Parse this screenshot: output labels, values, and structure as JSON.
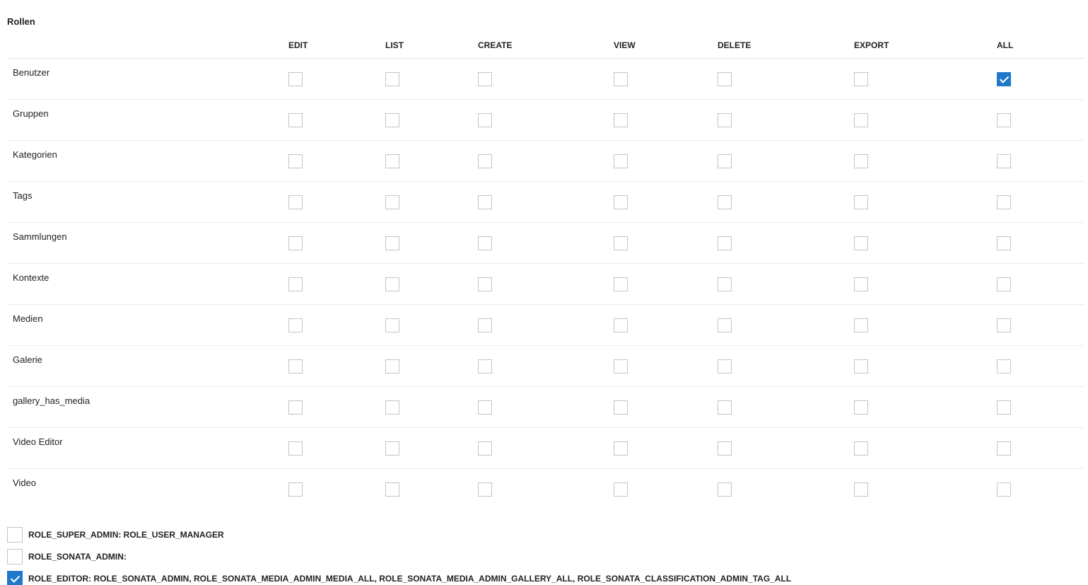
{
  "section_title": "Rollen",
  "columns": [
    "EDIT",
    "LIST",
    "CREATE",
    "VIEW",
    "DELETE",
    "EXPORT",
    "ALL"
  ],
  "rows": [
    {
      "label": "Benutzer",
      "checks": [
        false,
        false,
        false,
        false,
        false,
        false,
        true
      ]
    },
    {
      "label": "Gruppen",
      "checks": [
        false,
        false,
        false,
        false,
        false,
        false,
        false
      ]
    },
    {
      "label": "Kategorien",
      "checks": [
        false,
        false,
        false,
        false,
        false,
        false,
        false
      ]
    },
    {
      "label": "Tags",
      "checks": [
        false,
        false,
        false,
        false,
        false,
        false,
        false
      ]
    },
    {
      "label": "Sammlungen",
      "checks": [
        false,
        false,
        false,
        false,
        false,
        false,
        false
      ]
    },
    {
      "label": "Kontexte",
      "checks": [
        false,
        false,
        false,
        false,
        false,
        false,
        false
      ]
    },
    {
      "label": "Medien",
      "checks": [
        false,
        false,
        false,
        false,
        false,
        false,
        false
      ]
    },
    {
      "label": "Galerie",
      "checks": [
        false,
        false,
        false,
        false,
        false,
        false,
        false
      ]
    },
    {
      "label": "gallery_has_media",
      "checks": [
        false,
        false,
        false,
        false,
        false,
        false,
        false
      ]
    },
    {
      "label": "Video Editor",
      "checks": [
        false,
        false,
        false,
        false,
        false,
        false,
        false
      ]
    },
    {
      "label": "Video",
      "checks": [
        false,
        false,
        false,
        false,
        false,
        false,
        false
      ]
    }
  ],
  "extra_roles": [
    {
      "label": "ROLE_SUPER_ADMIN: ROLE_USER_MANAGER",
      "checked": false
    },
    {
      "label": "ROLE_SONATA_ADMIN:",
      "checked": false
    },
    {
      "label": "ROLE_EDITOR: ROLE_SONATA_ADMIN, ROLE_SONATA_MEDIA_ADMIN_MEDIA_ALL, ROLE_SONATA_MEDIA_ADMIN_GALLERY_ALL, ROLE_SONATA_CLASSIFICATION_ADMIN_TAG_ALL",
      "checked": true
    }
  ],
  "colors": {
    "checkbox_checked": "#1f78c9",
    "checkbox_border": "#c4c4c4"
  }
}
